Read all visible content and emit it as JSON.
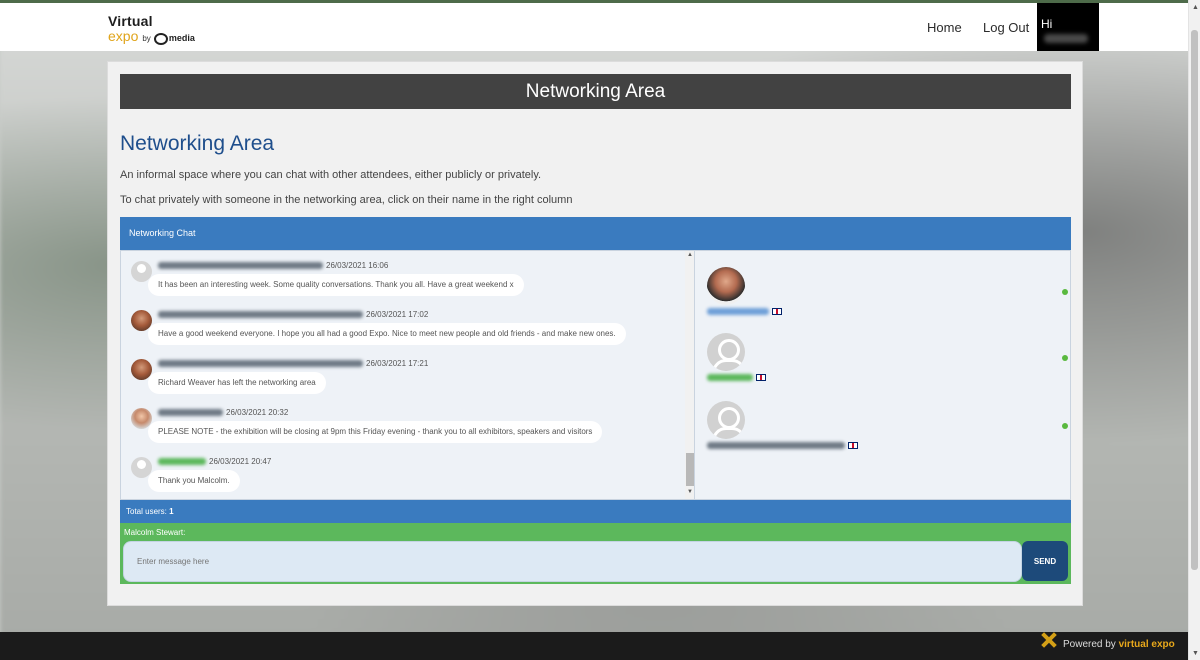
{
  "header": {
    "logo_line1": "Virtual",
    "logo_line2": "expo",
    "logo_by": "by",
    "logo_media": "media",
    "nav_home": "Home",
    "nav_logout": "Log Out",
    "greeting": "Hi"
  },
  "panel": {
    "header_title": "Networking Area",
    "page_title": "Networking Area",
    "intro_1": "An informal space where you can chat with other attendees, either publicly or privately.",
    "intro_2": "To chat privately with someone in the networking area, click on their name in the right column"
  },
  "chat": {
    "title": "Networking Chat",
    "messages": [
      {
        "time": "26/03/2021 16:06",
        "text": "It has been an interesting week. Some quality conversations. Thank you all. Have a great weekend x"
      },
      {
        "time": "26/03/2021 17:02",
        "text": "Have a good weekend everyone. I hope you all had a good Expo. Nice to meet new people and old friends - and make new ones."
      },
      {
        "time": "26/03/2021 17:21",
        "text": "Richard Weaver has left the networking area"
      },
      {
        "time": "26/03/2021 20:32",
        "text": "PLEASE NOTE - the exhibition will be closing at 9pm this Friday evening - thank you to all exhibitors, speakers and visitors"
      },
      {
        "time": "26/03/2021 20:47",
        "text": "Thank you Malcolm."
      }
    ],
    "total_users_label": "Total users:",
    "total_users_value": "1",
    "compose_name": "Malcolm Stewart:",
    "input_placeholder": "Enter message here",
    "send_label": "SEND"
  },
  "footer": {
    "powered_by": "Powered by",
    "brand": "virtual expo"
  },
  "colors": {
    "panel_header": "#424242",
    "title_blue": "#1e4e8c",
    "chat_blue": "#3a7bbf",
    "compose_green": "#5cb85c",
    "send_navy": "#1d4a7a",
    "online_green": "#59b93f",
    "logo_orange": "#e0a41a"
  }
}
